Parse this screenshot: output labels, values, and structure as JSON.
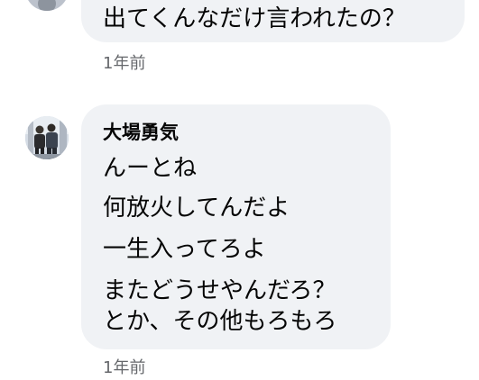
{
  "previous_comment": {
    "text": "出てくんなだけ言われたの？",
    "timestamp": "1年前"
  },
  "comment": {
    "author": "大場勇気",
    "lines": [
      "んーとね",
      "何放火してんだよ",
      "一生入ってろよ",
      "またどうせやんだろ？",
      "とか、その他もろもろ"
    ],
    "timestamp": "1年前"
  },
  "colors": {
    "bubble_background": "#f0f2f5",
    "text": "#050505",
    "timestamp": "#65676b"
  }
}
